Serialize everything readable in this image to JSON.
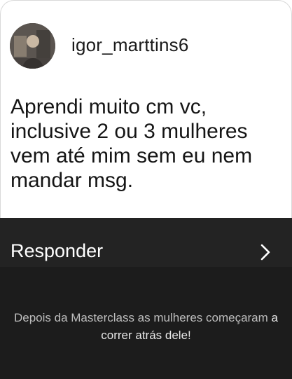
{
  "comment": {
    "username": "igor_marttins6",
    "avatar_icon": "profile-photo-icon",
    "text": "Aprendi muito cm vc,\ninclusive 2 ou 3 mulheres\nvem até mim sem eu nem\nmandar msg."
  },
  "reply": {
    "label": "Responder",
    "chevron_icon": "chevron-right-icon"
  },
  "caption": {
    "part1": "Depois da Masterclass as mulheres começaram ",
    "part2": "a correr atrás dele!"
  },
  "colors": {
    "card_bg": "#ffffff",
    "reply_bar_bg": "#232323",
    "caption_bg": "#1c1c1c",
    "caption_text": "#bdbdbd"
  }
}
